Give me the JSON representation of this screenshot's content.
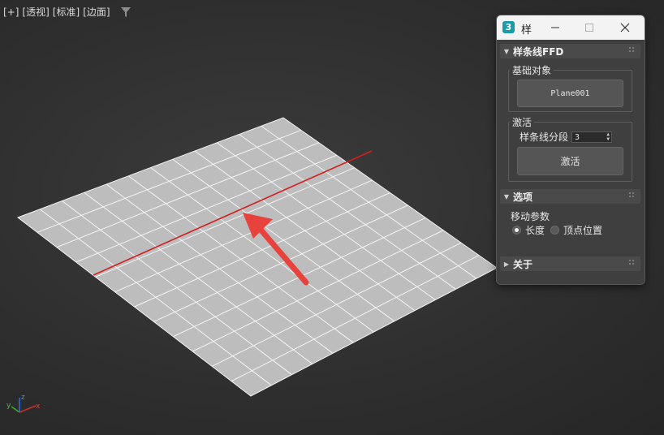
{
  "viewport": {
    "labels": [
      "[+]",
      "[透视]",
      "[标准]",
      "[边面]"
    ],
    "filter_icon": "filter-icon",
    "axis_gizmo": {
      "x": "x",
      "y": "y",
      "z": "z"
    },
    "colors": {
      "plane": "#bdbdbd",
      "grid_lines": "#f2f2f2",
      "spline": "#d11f1f",
      "arrow": "#e8423c"
    }
  },
  "panel": {
    "title": "样",
    "app_icon_text": "3",
    "rollouts": {
      "spline_ffd": {
        "title": "样条线FFD",
        "base_object_group": "基础对象",
        "object_button": "Plane001",
        "activate_group": "激活",
        "segments_label": "样条线分段",
        "segments_value": "3",
        "activate_button": "激活"
      },
      "options": {
        "title": "选项",
        "move_params_label": "移动参数",
        "radio_length": "长度",
        "radio_vertex": "顶点位置",
        "selected": "长度"
      },
      "about": {
        "title": "关于"
      }
    }
  }
}
